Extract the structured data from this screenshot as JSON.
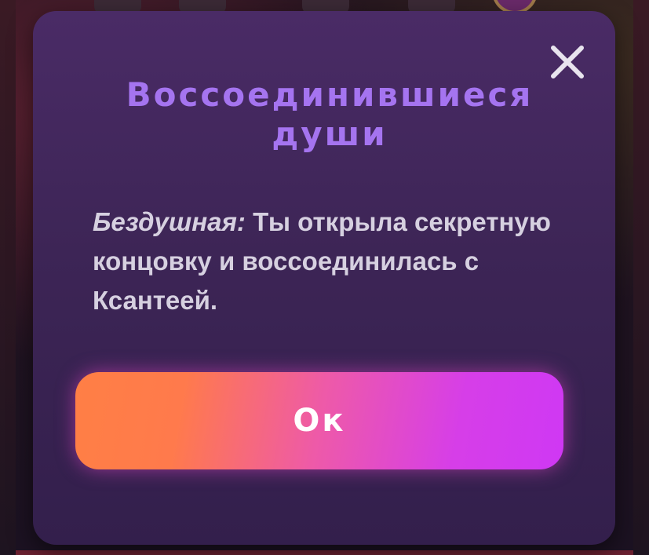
{
  "dialog": {
    "title": "Воссоединившиеся души",
    "message_prefix": "Бездушная:",
    "message_text": " Ты открыла секретную концовку и воссоединилась с Ксантеей.",
    "ok_label": "Ок",
    "close_icon": "close-icon"
  },
  "colors": {
    "title": "#a574f0",
    "modal_background": "#3d2556",
    "button_gradient_start": "#ff7f45",
    "button_gradient_end": "#cf38f4",
    "message_text": "#d6d0e0"
  }
}
